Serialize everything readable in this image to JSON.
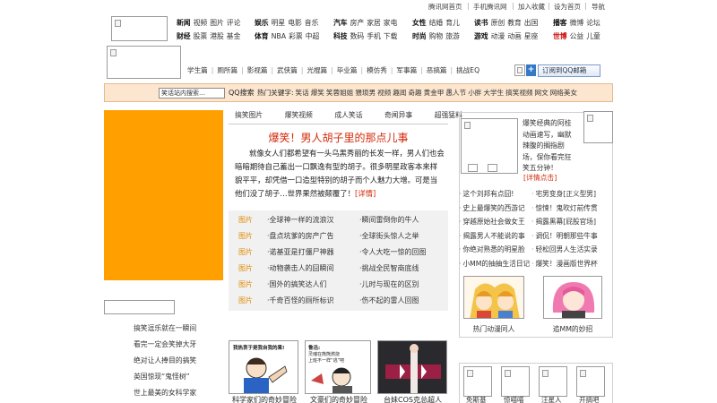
{
  "top_links": [
    "腾讯网首页",
    "手机腾讯网",
    "加入收藏",
    "设为首页",
    "导航"
  ],
  "portal_nav": [
    {
      "rows": [
        [
          "新闻",
          "视频",
          "图片",
          "评论"
        ],
        [
          "财经",
          "股票",
          "港股",
          "基金"
        ]
      ]
    },
    {
      "rows": [
        [
          "娱乐",
          "明星",
          "电影",
          "音乐"
        ],
        [
          "体育",
          "NBA",
          "彩票",
          "中超"
        ]
      ]
    },
    {
      "rows": [
        [
          "汽车",
          "房产",
          "家居",
          "家电"
        ],
        [
          "科技",
          "数码",
          "手机",
          "下载"
        ]
      ]
    },
    {
      "rows": [
        [
          "女性",
          "结婚",
          "育儿"
        ],
        [
          "时尚",
          "购物",
          "旅游"
        ]
      ]
    },
    {
      "rows": [
        [
          "读书",
          "原创",
          "教育",
          "出国"
        ],
        [
          "游戏",
          "动漫",
          "动画",
          "星座"
        ]
      ]
    },
    {
      "rows": [
        [
          "播客",
          "微博",
          "论坛"
        ],
        [
          "世博",
          "公益",
          "儿童"
        ]
      ]
    }
  ],
  "category_nav": [
    "学生篇",
    "厕所篇",
    "影视篇",
    "武侠篇",
    "光棍篇",
    "毕业篇",
    "模仿秀",
    "军事篇",
    "恶搞篇",
    "挑战EQ"
  ],
  "subscribe_label": "订阅到QQ邮箱",
  "subscribe_plus": "+",
  "search": {
    "placeholder": "笑话站内搜索…",
    "button": "QQ搜索",
    "hot_label": "热门关键字:",
    "hot_words": [
      "笑话",
      "爆笑",
      "笑蓉姐姐",
      "猥琐男",
      "视频",
      "趣闻",
      "奇趣",
      "黄金甲",
      "愚人节",
      "小胖",
      "大学生",
      "搞笑视频",
      "网文",
      "网络美女"
    ]
  },
  "tabs": [
    "搞笑图片",
    "爆笑视频",
    "成人笑话",
    "奇闻异事",
    "超强猛料"
  ],
  "headline": "爆笑！男人胡子里的那点儿事",
  "lead_text": "就像女人们都希望有一头乌黑秀丽的长发一样，男人们也会暗暗期待自己蓄出一口飘逸有型的胡子。很多明星政客本来样貌平平，却凭借一口造型特别的胡子而个人魅力大增。可是当他们没了胡子…世界果然被颠覆了！",
  "lead_more": "[详情]",
  "list_tag": "图片",
  "list_left": [
    "·全球神一样的流浪汉",
    "·盘点坑爹的房产广告",
    "·诺基亚是打僵尸神器",
    "·动物袭击人的囧瞬间",
    "·国外的搞笑达人们",
    "·千奇百怪的厕所标识"
  ],
  "list_right": [
    "·瞬间雷倒你的牛人",
    "·全球街头惊人之举",
    "·令人大吃一惊的回图",
    "·挑战全民智商底线",
    "·儿时与现在的区别",
    "·伤不起的雷人回图"
  ],
  "right_feature_text": "爆笑经典的阿桂动画速写，幽默辣腹的搁指剧场，保你看完狂笑五分钟！",
  "right_detail": "[详情点击]",
  "right_list_left": [
    "这个刘邦有点囧!",
    "史上最爆笑的西游记",
    "穿越原始社会做女王",
    "揭露男人不能说的事",
    "你绝对熟悉的明星脸",
    "小MM的抽抽生活日记"
  ],
  "right_list_right": [
    "宅男变身[正义型男]",
    "惊悚！鬼吹灯前传贯",
    "揭露黑幕[屁股官场]",
    "调侃！明朝那些牛事",
    "轻松回男人生活实录",
    "爆笑！漫画版世界杯"
  ],
  "right_captions": [
    "热门动漫同人",
    "追MM的妙招"
  ],
  "left_links": [
    "搞笑逗乐就在一瞬间",
    "看完一定会笑掉大牙",
    "绝对让人捧目的搞笑",
    "英国惊现“鬼怪树”",
    "世上最美的女科学家"
  ],
  "bottom_captions": [
    "科学家们的奇妙冒险",
    "文豪们的奇妙冒险",
    "台妹COS克总超人"
  ],
  "comic_texts": [
    "我热衷于是我自我的果!",
    "鲁迅:",
    "灵魂在熊熊燃烧",
    "上班不一样“逃”吧"
  ],
  "bottom_grid_captions": [
    "免斯基",
    "惊喵喵",
    "汪星人",
    "开搞吧"
  ]
}
